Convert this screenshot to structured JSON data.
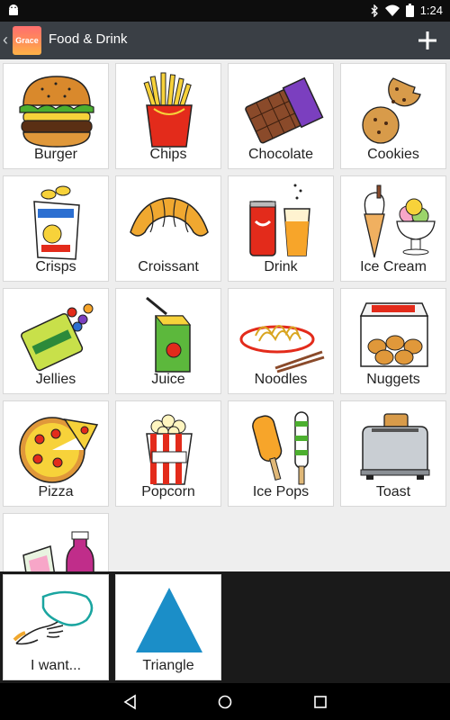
{
  "status_bar": {
    "time": "1:24"
  },
  "action_bar": {
    "profile_name": "Grace",
    "title": "Food & Drink",
    "add_icon": "plus-icon",
    "back_icon": "chevron-left-icon"
  },
  "tiles": [
    {
      "label": "Burger"
    },
    {
      "label": "Chips"
    },
    {
      "label": "Chocolate"
    },
    {
      "label": "Cookies"
    },
    {
      "label": "Crisps"
    },
    {
      "label": "Croissant"
    },
    {
      "label": "Drink"
    },
    {
      "label": "Ice Cream"
    },
    {
      "label": "Jellies"
    },
    {
      "label": "Juice"
    },
    {
      "label": "Noodles"
    },
    {
      "label": "Nuggets"
    },
    {
      "label": "Pizza"
    },
    {
      "label": "Popcorn"
    },
    {
      "label": "Ice Pops"
    },
    {
      "label": "Toast"
    }
  ],
  "sentence": [
    {
      "label": "I want..."
    },
    {
      "label": "Triangle"
    }
  ],
  "colors": {
    "action_bar": "#3a3f45",
    "triangle": "#1b8ec8"
  },
  "nav": {
    "back_icon": "back-triangle-icon",
    "home_icon": "home-circle-icon",
    "recents_icon": "recents-square-icon"
  }
}
